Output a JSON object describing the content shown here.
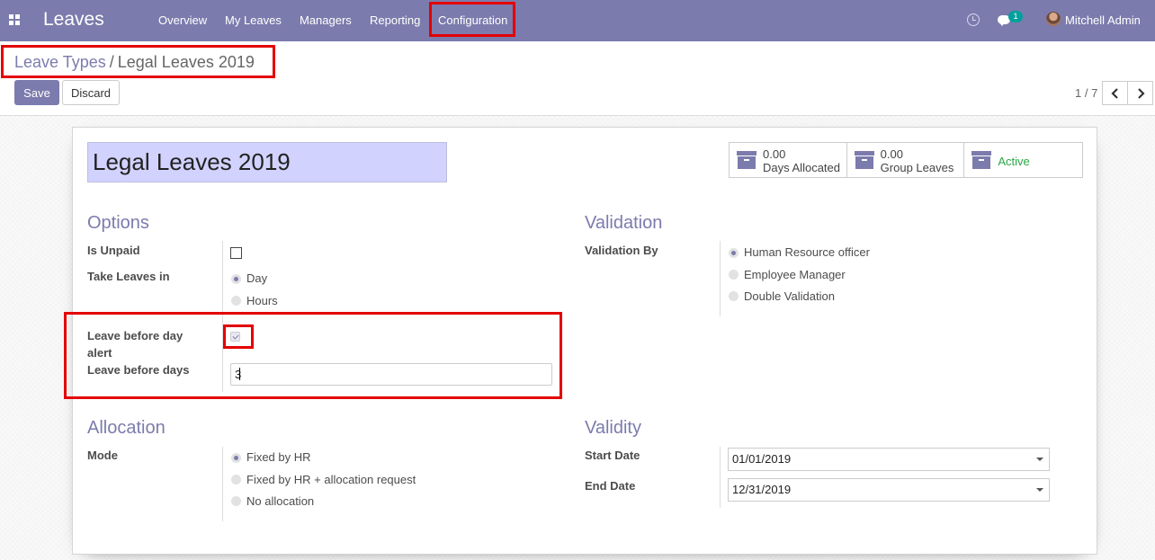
{
  "navbar": {
    "app_title": "Leaves",
    "menu": [
      "Overview",
      "My Leaves",
      "Managers",
      "Reporting",
      "Configuration"
    ],
    "chat_badge": "1",
    "user_name": "Mitchell Admin"
  },
  "breadcrumb": {
    "parent": "Leave Types",
    "separator": "/",
    "current": "Legal Leaves 2019"
  },
  "buttons": {
    "save": "Save",
    "discard": "Discard"
  },
  "pager": {
    "value": "1 / 7"
  },
  "record": {
    "name": "Legal Leaves 2019"
  },
  "smart_buttons": {
    "days_allocated": {
      "value": "0.00",
      "label": "Days Allocated"
    },
    "group_leaves": {
      "value": "0.00",
      "label": "Group Leaves"
    },
    "active": {
      "label": "Active"
    }
  },
  "options": {
    "title": "Options",
    "is_unpaid_label": "Is Unpaid",
    "is_unpaid": false,
    "take_leaves_label": "Take Leaves in",
    "take_leaves_options": [
      "Day",
      "Hours"
    ],
    "take_leaves_selected": "Day",
    "leave_alert_label_1": "Leave before day",
    "leave_alert_label_2": "alert",
    "leave_alert": true,
    "leave_days_label": "Leave before days",
    "leave_days_value": "3"
  },
  "validation": {
    "title": "Validation",
    "by_label": "Validation By",
    "options": [
      "Human Resource officer",
      "Employee Manager",
      "Double Validation"
    ],
    "selected": "Human Resource officer"
  },
  "allocation": {
    "title": "Allocation",
    "mode_label": "Mode",
    "options": [
      "Fixed by HR",
      "Fixed by HR + allocation request",
      "No allocation"
    ],
    "selected": "Fixed by HR"
  },
  "validity": {
    "title": "Validity",
    "start_label": "Start Date",
    "start_value": "01/01/2019",
    "end_label": "End Date",
    "end_value": "12/31/2019"
  },
  "colors": {
    "brand": "#7c7bad",
    "highlight": "#e30000",
    "active": "#28a745"
  }
}
